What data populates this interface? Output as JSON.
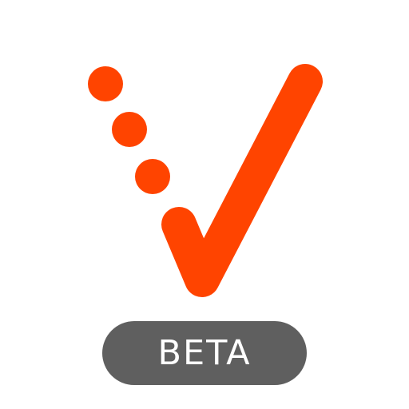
{
  "badge": {
    "label": "BETA"
  },
  "logo": {
    "icon": "checkmark-with-dots-icon",
    "dot_count": 3
  },
  "colors": {
    "accent": "#ff4400",
    "badge_background": "#5f5f5f",
    "badge_text": "#ffffff",
    "background": "#ffffff"
  }
}
